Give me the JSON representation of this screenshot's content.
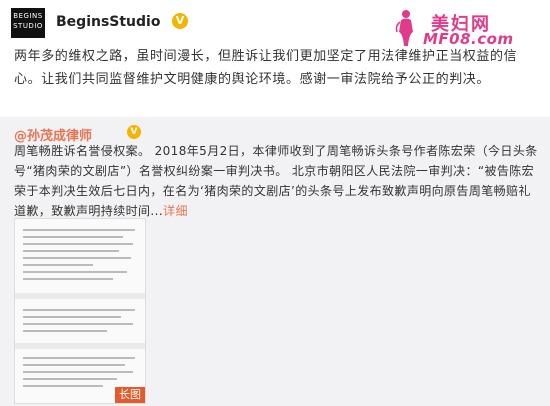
{
  "header": {
    "avatar_line1": "BEGINS",
    "avatar_line2": "STUDIO",
    "username": "BeginsStudio",
    "verified_mark": "V",
    "watermark_title": "美妇网",
    "watermark_url": "MF08.com"
  },
  "post": {
    "text": "两年多的维权之路，虽时间漫长，但胜诉让我们更加坚定了用法律维护正当权益的信心。让我们共同监督维护文明健康的舆论环境。感谢一审法院给予公正的判决。"
  },
  "repost": {
    "author": "@孙茂成律师",
    "verified_mark": "V",
    "text": "周笔畅胜诉名誉侵权案。 2018年5月2日，本律师收到了周笔畅诉头条号作者陈宏荣（今日头条号“猪肉荣的文剧店”）名誉权纠纷案一审判决书。 北京市朝阳区人民法院一审判决：“被告陈宏荣于本判决生效后七日内，在名为‘猪肉荣的文剧店’的头条号上发布致歉声明向原告周笔畅赔礼道歉，致歉声明持续时间...",
    "more_label": "详细",
    "thumbnail_badge": "长图"
  },
  "colors": {
    "accent_orange": "#eb7350",
    "watermark_pink": "#e23a8a",
    "verified_gold": "#f5b400",
    "repost_bg": "#f2f2f5"
  }
}
